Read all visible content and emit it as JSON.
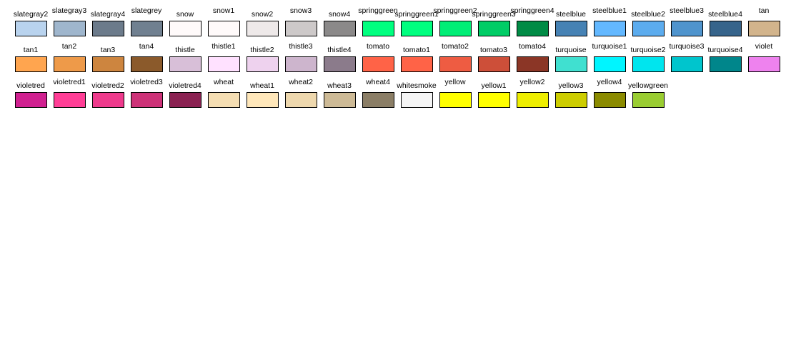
{
  "swatches": [
    {
      "name": "slategray2",
      "color": "#b9d3ee"
    },
    {
      "name": "slategray3",
      "color": "#9fb6cd"
    },
    {
      "name": "slategray4",
      "color": "#6c7b8b"
    },
    {
      "name": "slategrey",
      "color": "#708090"
    },
    {
      "name": "snow",
      "color": "#fffafa"
    },
    {
      "name": "snow1",
      "color": "#fffafa"
    },
    {
      "name": "snow2",
      "color": "#eee9e9"
    },
    {
      "name": "snow3",
      "color": "#cdc9c9"
    },
    {
      "name": "snow4",
      "color": "#8b8989"
    },
    {
      "name": "springgreen",
      "color": "#00ff7f"
    },
    {
      "name": "springgreen1",
      "color": "#00ff7f"
    },
    {
      "name": "springgreen2",
      "color": "#00ee76"
    },
    {
      "name": "springgreen3",
      "color": "#00cd66"
    },
    {
      "name": "springgreen4",
      "color": "#008b45"
    },
    {
      "name": "steelblue",
      "color": "#4682b4"
    },
    {
      "name": "steelblue1",
      "color": "#63b8ff"
    },
    {
      "name": "steelblue2",
      "color": "#5cacee"
    },
    {
      "name": "steelblue3",
      "color": "#4f94cd"
    },
    {
      "name": "steelblue4",
      "color": "#36648b"
    },
    {
      "name": "tan",
      "color": "#d2b48c"
    },
    {
      "name": "tan1",
      "color": "#ffa54f"
    },
    {
      "name": "tan2",
      "color": "#ee9a49"
    },
    {
      "name": "tan3",
      "color": "#cd853f"
    },
    {
      "name": "tan4",
      "color": "#8b5a2b"
    },
    {
      "name": "thistle",
      "color": "#d8bfd8"
    },
    {
      "name": "thistle1",
      "color": "#ffe1ff"
    },
    {
      "name": "thistle2",
      "color": "#eed2ee"
    },
    {
      "name": "thistle3",
      "color": "#cdb5cd"
    },
    {
      "name": "thistle4",
      "color": "#8b7b8b"
    },
    {
      "name": "tomato",
      "color": "#ff6347"
    },
    {
      "name": "tomato1",
      "color": "#ff6347"
    },
    {
      "name": "tomato2",
      "color": "#ee5c42"
    },
    {
      "name": "tomato3",
      "color": "#cd4f39"
    },
    {
      "name": "tomato4",
      "color": "#8b3626"
    },
    {
      "name": "turquoise",
      "color": "#40e0d0"
    },
    {
      "name": "turquoise1",
      "color": "#00f5ff"
    },
    {
      "name": "turquoise2",
      "color": "#00e5ee"
    },
    {
      "name": "turquoise3",
      "color": "#00c5cd"
    },
    {
      "name": "turquoise4",
      "color": "#00868b"
    },
    {
      "name": "violet",
      "color": "#ee82ee"
    },
    {
      "name": "violetred",
      "color": "#d02090"
    },
    {
      "name": "violetred1",
      "color": "#ff3e96"
    },
    {
      "name": "violetred2",
      "color": "#ee3a8c"
    },
    {
      "name": "violetred3",
      "color": "#cd3278"
    },
    {
      "name": "violetred4",
      "color": "#8b2252"
    },
    {
      "name": "wheat",
      "color": "#f5deb3"
    },
    {
      "name": "wheat1",
      "color": "#ffe7ba"
    },
    {
      "name": "wheat2",
      "color": "#eed8ae"
    },
    {
      "name": "wheat3",
      "color": "#cdba96"
    },
    {
      "name": "wheat4",
      "color": "#8b7e66"
    },
    {
      "name": "whitesmoke",
      "color": "#f5f5f5"
    },
    {
      "name": "yellow",
      "color": "#ffff00"
    },
    {
      "name": "yellow1",
      "color": "#ffff00"
    },
    {
      "name": "yellow2",
      "color": "#eeee00"
    },
    {
      "name": "yellow3",
      "color": "#cdcd00"
    },
    {
      "name": "yellow4",
      "color": "#8b8b00"
    },
    {
      "name": "yellowgreen",
      "color": "#9acd32"
    }
  ]
}
